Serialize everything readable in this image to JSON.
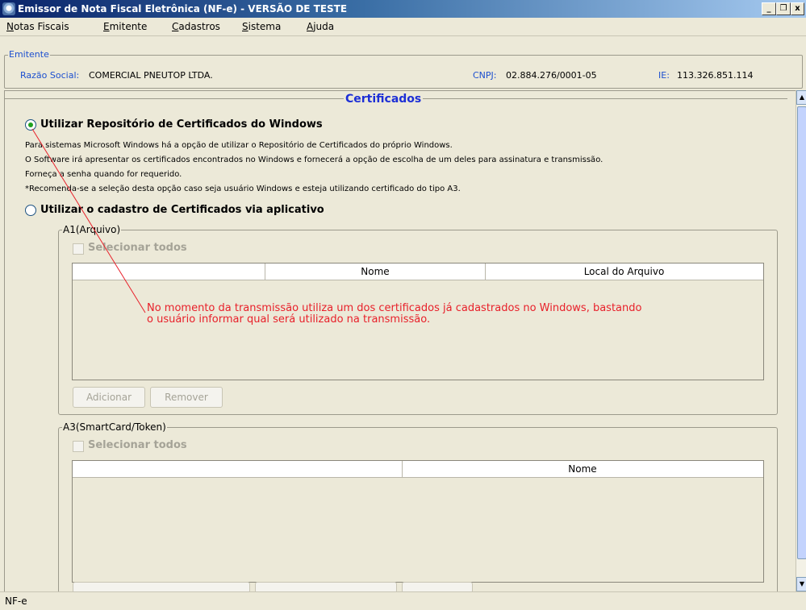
{
  "window": {
    "title": "Emissor de Nota Fiscal Eletrônica (NF-e) - VERSÃO DE TESTE",
    "controls": {
      "minimize": "_",
      "restore": "❐",
      "close": "x"
    }
  },
  "menu": [
    {
      "pre": "",
      "u": "N",
      "post": "otas Fiscais"
    },
    {
      "pre": "",
      "u": "E",
      "post": "mitente"
    },
    {
      "pre": "",
      "u": "C",
      "post": "adastros"
    },
    {
      "pre": "",
      "u": "S",
      "post": "istema"
    },
    {
      "pre": "",
      "u": "A",
      "post": "juda"
    }
  ],
  "emitente": {
    "legend": "Emitente",
    "razao_social_label": "Razão Social:",
    "razao_social": "COMERCIAL PNEUTOP LTDA.",
    "cnpj_label": "CNPJ:",
    "cnpj": "02.884.276/0001-05",
    "ie_label": "IE:",
    "ie": "113.326.851.114"
  },
  "certificados": {
    "title": "Certificados",
    "option_windows": {
      "label": "Utilizar Repositório de Certificados do Windows",
      "checked": true,
      "lines": [
        "Para sistemas Microsoft Windows há a opção de utilizar o Repositório de Certificados do próprio Windows.",
        "O Software irá apresentar os certificados encontrados no Windows e fornecerá a opção de escolha de um deles para assinatura e transmissão.",
        "Forneça a senha quando for requerido.",
        "*Recomenda-se a seleção desta opção caso seja usuário Windows e esteja utilizando certificado do tipo A3."
      ]
    },
    "option_app": {
      "label": "Utilizar o cadastro de Certificados via aplicativo",
      "checked": false
    },
    "a1": {
      "legend": "A1(Arquivo)",
      "select_all": "Selecionar todos",
      "columns": [
        "",
        "Nome",
        "Local do Arquivo"
      ],
      "add_button": "Adicionar",
      "remove_button": "Remover"
    },
    "a3": {
      "legend": "A3(SmartCard/Token)",
      "select_all": "Selecionar todos",
      "columns": [
        "",
        "Nome"
      ]
    }
  },
  "annotation": {
    "line1": "No momento da transmissão utiliza um dos certificados já cadastrados no Windows, bastando",
    "line2": "o usuário informar qual será utilizado na transmissão."
  },
  "status": {
    "text": "NF-e"
  },
  "colors": {
    "label_blue": "#1c4fcf",
    "title_blue": "#1d2fd6",
    "annotation_red": "#e8202a"
  }
}
